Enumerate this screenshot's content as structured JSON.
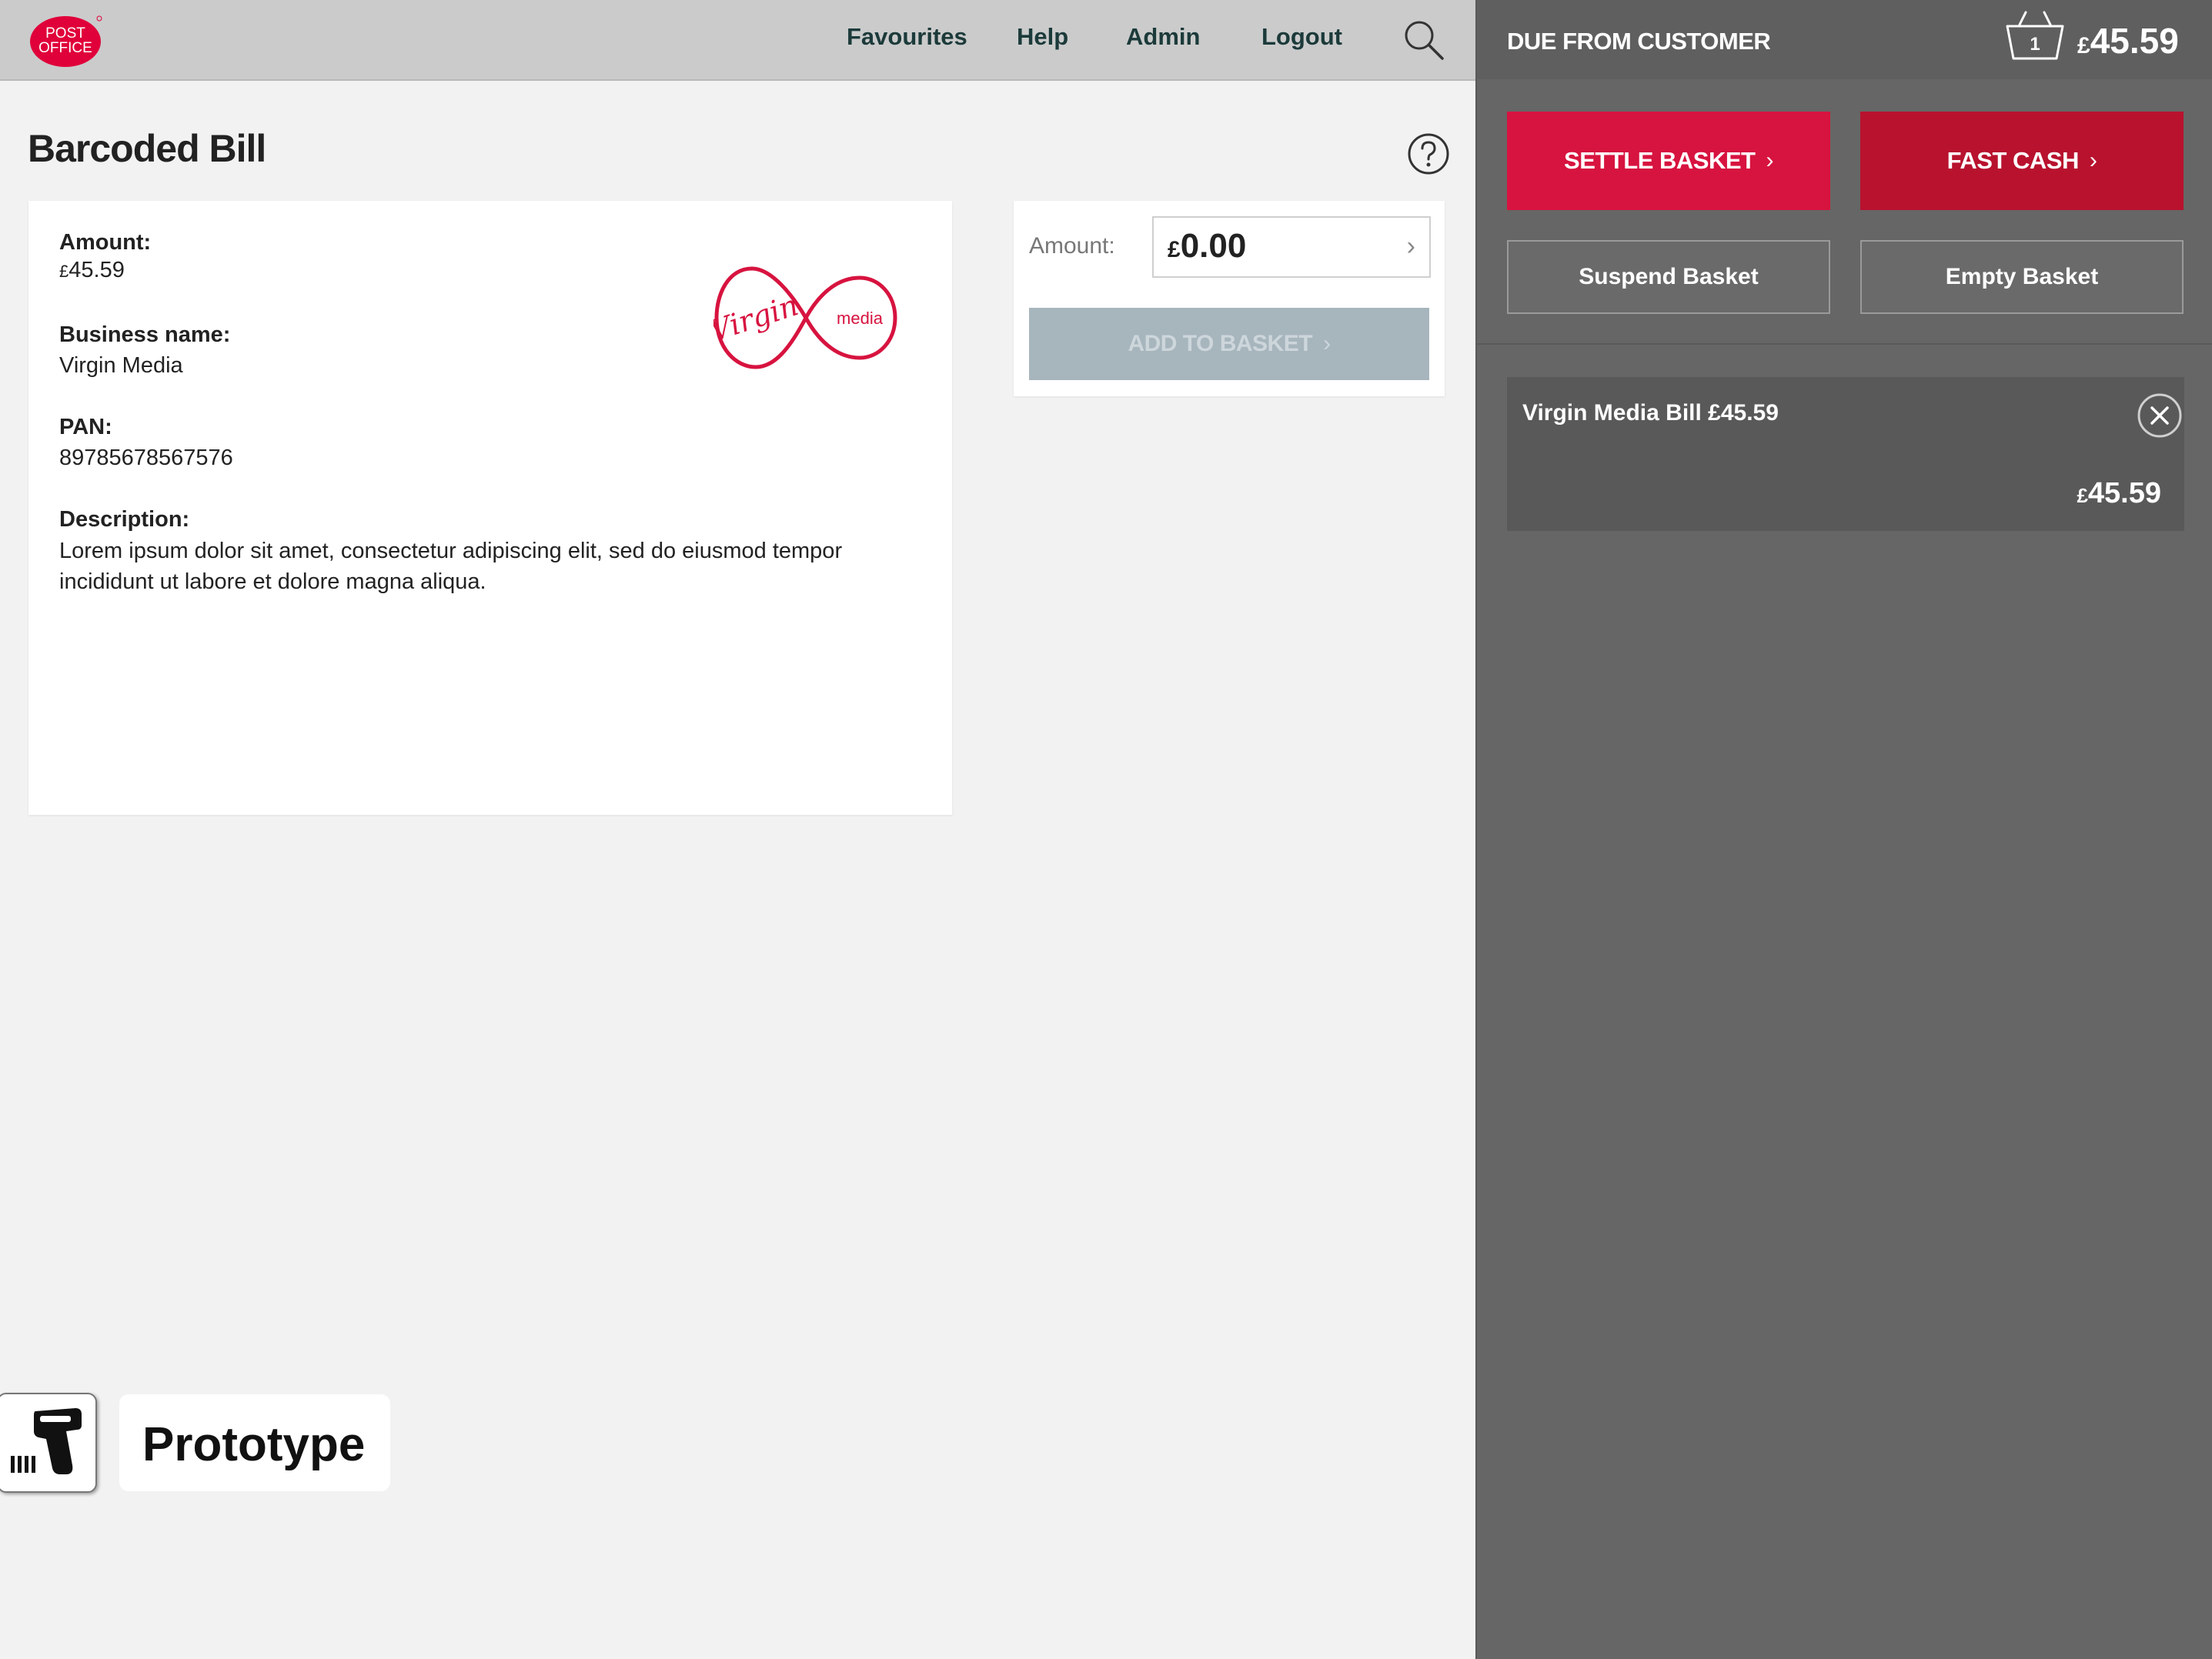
{
  "brand": {
    "logo_line1": "POST",
    "logo_line2": "OFFICE",
    "color_red": "#e0003a"
  },
  "nav": {
    "items": [
      "Favourites",
      "Help",
      "Admin",
      "Logout"
    ]
  },
  "due": {
    "label": "DUE FROM CUSTOMER",
    "basket_count": "1",
    "currency": "£",
    "total": "45.59"
  },
  "actions": {
    "settle": "SETTLE BASKET",
    "fast_cash": "FAST CASH",
    "suspend": "Suspend Basket",
    "empty": "Empty Basket",
    "settle_color": "#d7133f",
    "fast_cash_color": "#b8122e"
  },
  "basket": {
    "items": [
      {
        "title": "Virgin Media Bill £45.59",
        "currency": "£",
        "price": "45.59"
      }
    ]
  },
  "page": {
    "title": "Barcoded Bill"
  },
  "bill": {
    "amount_label": "Amount:",
    "amount_currency": "£",
    "amount_value": "45.59",
    "business_label": "Business name:",
    "business_value": "Virgin Media",
    "pan_label": "PAN:",
    "pan_value": "89785678567576",
    "description_label": "Description:",
    "description_value": "Lorem ipsum dolor sit amet, consectetur adipiscing elit, sed do eiusmod tempor incididunt ut labore et dolore magna aliqua.",
    "logo_text_virgin": "Virgin",
    "logo_text_media": "media"
  },
  "amount_entry": {
    "label": "Amount:",
    "currency": "£",
    "value": "0.00",
    "add_button": "ADD TO BASKET"
  },
  "prototype": {
    "label": "Prototype"
  }
}
